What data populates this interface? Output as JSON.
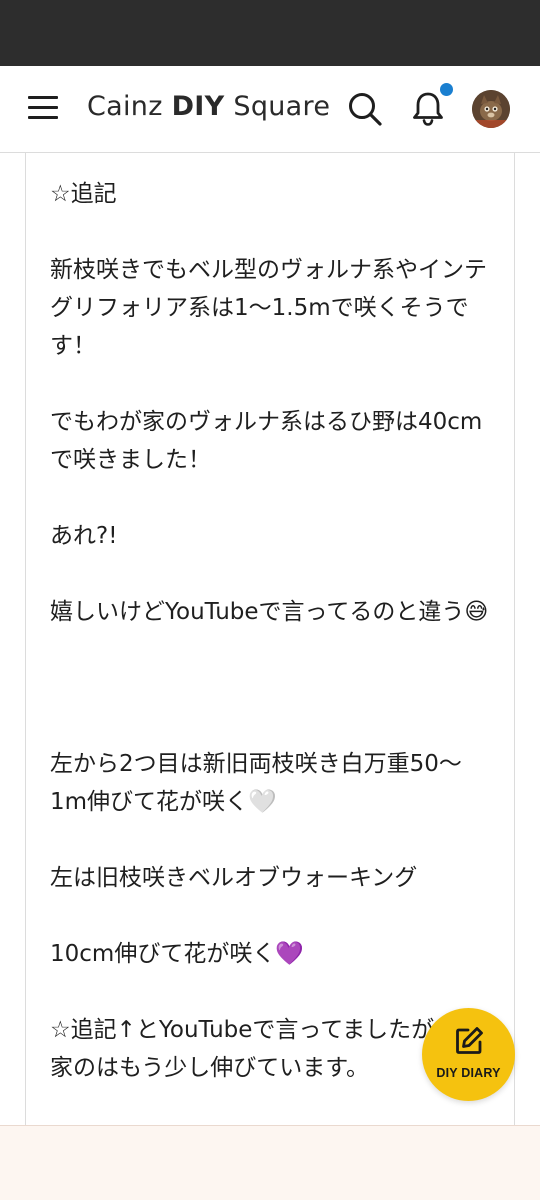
{
  "header": {
    "logo_text_1": "Cainz ",
    "logo_text_2": "DIY",
    "logo_text_3": " Square",
    "icons": [
      "menu-icon",
      "search-icon",
      "bell-icon"
    ],
    "notification_dot_color": "#1a7fd0"
  },
  "post": {
    "paragraphs": [
      "☆追記",
      "新枝咲きでもベル型のヴォルナ系やインテグリフォリア系は1〜1.5mで咲くそうです！",
      "でもわが家のヴォルナ系はるひ野は40cmで咲きました！",
      "あれ?!",
      "嬉しいけどYouTubeで言ってるのと違う😅",
      "左から2つ目は新旧両枝咲き白万重50〜1m伸びて花が咲く🤍",
      "左は旧枝咲きベルオブウォーキング",
      "10cm伸びて花が咲く💜",
      "☆追記↑とYouTubeで言ってましたがわが家のはもう少し伸びています。"
    ]
  },
  "fab": {
    "label": "DIY DIARY",
    "icon": "edit-icon",
    "color": "#f5c20f"
  }
}
